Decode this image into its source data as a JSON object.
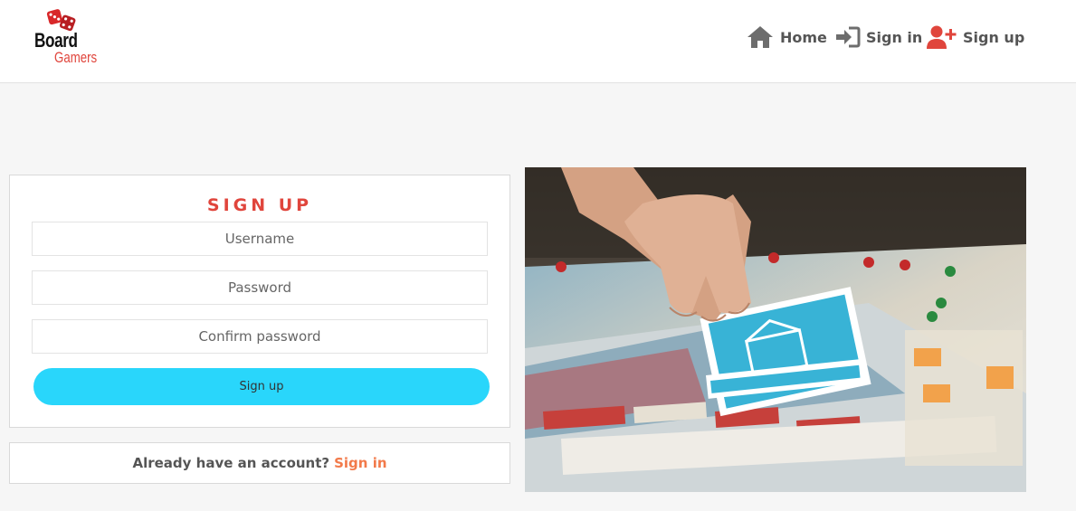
{
  "header": {
    "logo": {
      "line1": "Board",
      "line2": "Gamers"
    },
    "nav": [
      {
        "label": "Home",
        "icon": "home-icon"
      },
      {
        "label": "Sign in",
        "icon": "sign-in-icon"
      },
      {
        "label": "Sign up",
        "icon": "user-plus-icon"
      }
    ]
  },
  "signup_form": {
    "title": "SIGN UP",
    "username_placeholder": "Username",
    "password_placeholder": "Password",
    "confirm_placeholder": "Confirm password",
    "submit_label": "Sign up"
  },
  "account_prompt": {
    "text": "Already have an account?",
    "link": "Sign in"
  },
  "colors": {
    "accent_red": "#e0453c",
    "button_cyan": "#29d6fb",
    "link_orange": "#f27a4a"
  },
  "hero_image": {
    "subject": "board-game-photo"
  }
}
